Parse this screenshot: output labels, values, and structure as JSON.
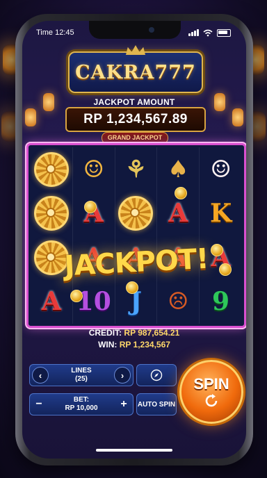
{
  "status_bar": {
    "time": "Time 12:45"
  },
  "logo": {
    "text": "CAKRA777"
  },
  "jackpot": {
    "label": "JACKPOT AMOUNT",
    "amount": "RP 1,234,567.89",
    "badge": "GRAND JACKPOT"
  },
  "reels": {
    "rows": [
      [
        "dharma-wheel",
        "laughing-buddha",
        "dancer",
        "golden-elephant",
        "lucky-cat"
      ],
      [
        "dharma-wheel",
        "A",
        "dharma-wheel",
        "A",
        "K"
      ],
      [
        "dharma-wheel",
        "A",
        "A",
        "A",
        "A"
      ],
      [
        "A",
        "10",
        "J",
        "barong-mask",
        "9"
      ]
    ],
    "overlay_text": "JACKPOT!"
  },
  "info": {
    "credit_label": "CREDIT:",
    "credit_value": "RP 987,654.21",
    "win_label": "WIN:",
    "win_value": "RP 1,234,567"
  },
  "controls": {
    "lines_label": "LINES",
    "lines_value": "(25)",
    "bet_label": "BET:",
    "bet_value": "RP 10,000",
    "auto_spin": "AUTO SPIN",
    "spin": "SPIN",
    "minus": "−",
    "plus": "+",
    "prev": "‹",
    "next": "›"
  },
  "colors": {
    "accent_gold": "#ffd86a",
    "reel_border": "#d94fcf",
    "spin_orange": "#f06a0c"
  }
}
